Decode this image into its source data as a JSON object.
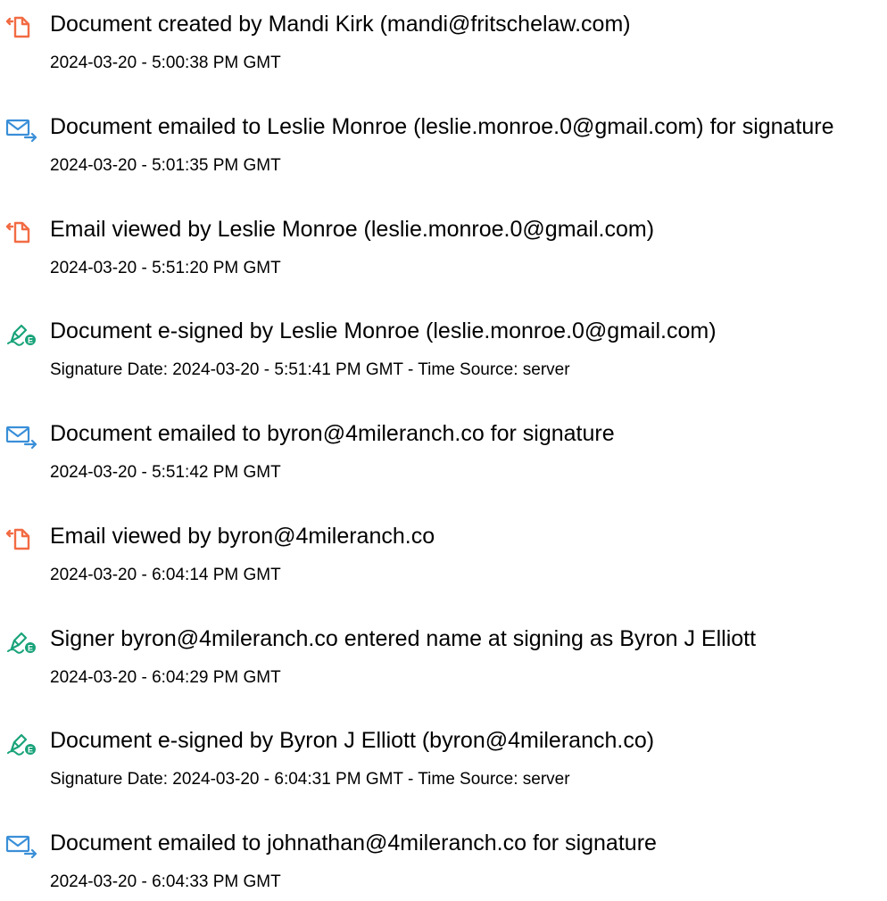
{
  "colors": {
    "doc_icon": "#f26b43",
    "email_icon": "#3a8fd8",
    "sign_icon": "#1aa37a",
    "text": "#000000"
  },
  "events": [
    {
      "icon": "document-icon",
      "title": "Document created by Mandi Kirk (mandi@fritschelaw.com)",
      "detail": "2024-03-20 - 5:00:38 PM GMT"
    },
    {
      "icon": "email-sent-icon",
      "title": "Document emailed to Leslie Monroe (leslie.monroe.0@gmail.com) for signature",
      "detail": "2024-03-20 - 5:01:35 PM GMT"
    },
    {
      "icon": "document-icon",
      "title": "Email viewed by Leslie Monroe (leslie.monroe.0@gmail.com)",
      "detail": "2024-03-20 - 5:51:20 PM GMT"
    },
    {
      "icon": "esign-icon",
      "title": "Document e-signed by Leslie Monroe (leslie.monroe.0@gmail.com)",
      "detail": "Signature Date: 2024-03-20 - 5:51:41 PM GMT - Time Source: server"
    },
    {
      "icon": "email-sent-icon",
      "title": "Document emailed to byron@4mileranch.co for signature",
      "detail": "2024-03-20 - 5:51:42 PM GMT"
    },
    {
      "icon": "document-icon",
      "title": "Email viewed by byron@4mileranch.co",
      "detail": "2024-03-20 - 6:04:14 PM GMT"
    },
    {
      "icon": "esign-icon",
      "title": "Signer byron@4mileranch.co entered name at signing as Byron J Elliott",
      "detail": "2024-03-20 - 6:04:29 PM GMT"
    },
    {
      "icon": "esign-icon",
      "title": "Document e-signed by Byron J Elliott (byron@4mileranch.co)",
      "detail": "Signature Date: 2024-03-20 - 6:04:31 PM GMT - Time Source: server"
    },
    {
      "icon": "email-sent-icon",
      "title": "Document emailed to johnathan@4mileranch.co for signature",
      "detail": "2024-03-20 - 6:04:33 PM GMT"
    }
  ]
}
